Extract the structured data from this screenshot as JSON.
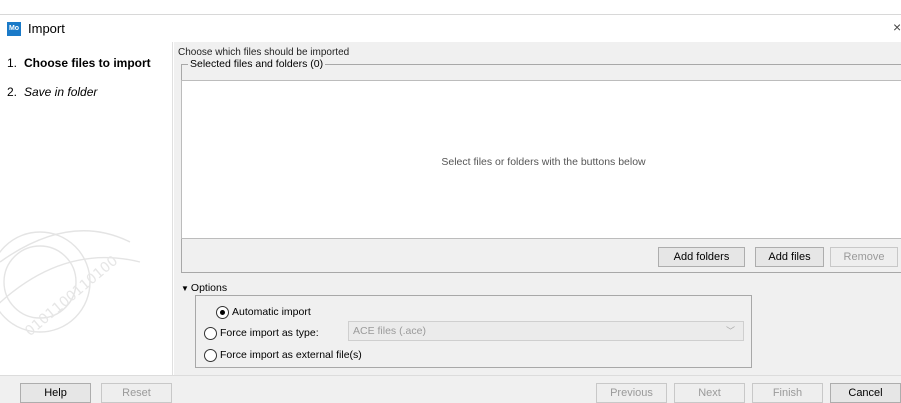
{
  "window": {
    "app_icon_label": "Mo",
    "title": "Import",
    "close_glyph": "×"
  },
  "steps": [
    {
      "number": "1.",
      "label": "Choose files to import"
    },
    {
      "number": "2.",
      "label": "Save in folder"
    }
  ],
  "main": {
    "instruction": "Choose which files should be imported",
    "selected_group_label": "Selected files and folders (0)",
    "empty_message": "Select files or folders with the buttons below",
    "buttons": {
      "add_folders": "Add folders",
      "add_files": "Add files",
      "remove": "Remove"
    }
  },
  "options": {
    "header": "Options",
    "radio_automatic": "Automatic import",
    "radio_force_type": "Force import as type:",
    "radio_external": "Force import as external file(s)",
    "type_value": "ACE files (.ace)",
    "selected": "Automatic import"
  },
  "footer": {
    "help": "Help",
    "reset": "Reset",
    "previous": "Previous",
    "next": "Next",
    "finish": "Finish",
    "cancel": "Cancel"
  },
  "colors": {
    "accent": "#1a7ac8",
    "panel": "#f0f0f0"
  }
}
